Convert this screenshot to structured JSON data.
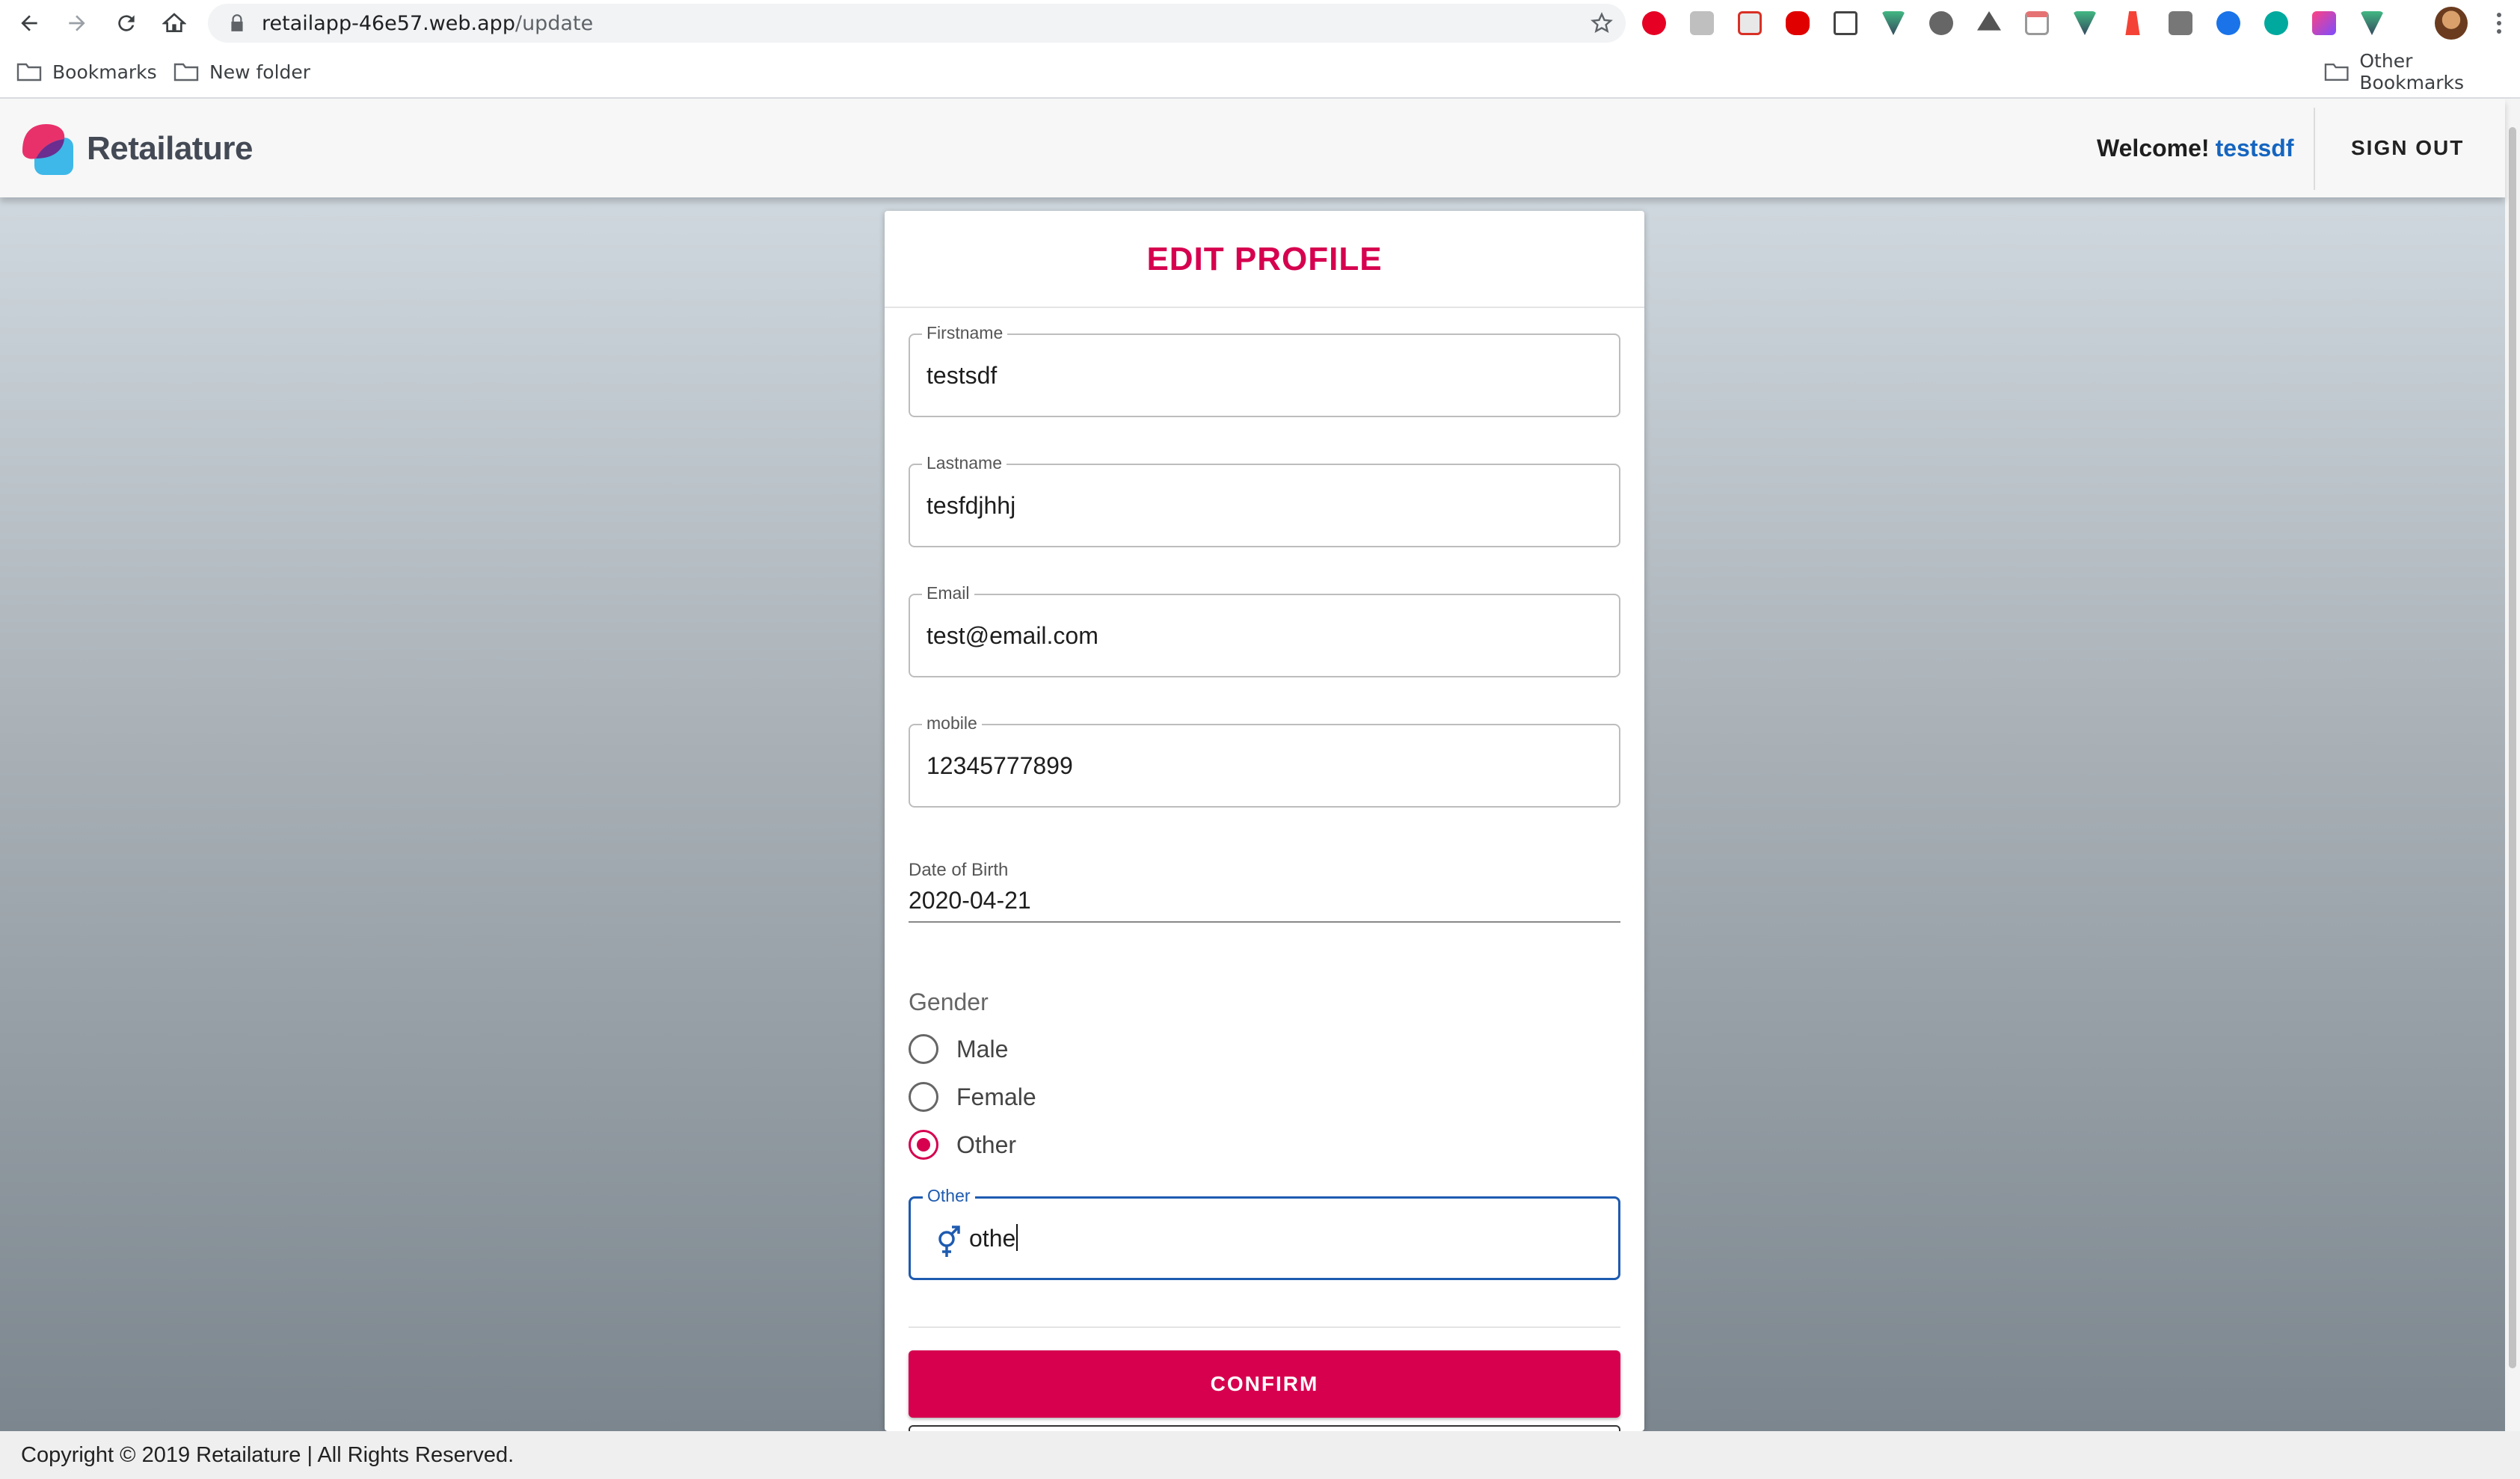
{
  "browser": {
    "url_host": "retailapp-46e57.web.app",
    "url_path": "/update",
    "bookmarks": [
      "Bookmarks",
      "New folder"
    ],
    "other_bookmarks": "Other Bookmarks"
  },
  "header": {
    "logo_text": "Retailature",
    "welcome": "Welcome!",
    "username": "testsdf",
    "signout": "SIGN OUT"
  },
  "form": {
    "title": "EDIT PROFILE",
    "firstname": {
      "label": "Firstname",
      "value": "testsdf"
    },
    "lastname": {
      "label": "Lastname",
      "value": "tesfdjhhj"
    },
    "email": {
      "label": "Email",
      "value": "test@email.com"
    },
    "mobile": {
      "label": "mobile",
      "value": "12345777899"
    },
    "dob": {
      "label": "Date of Birth",
      "value": "2020-04-21"
    },
    "gender": {
      "label": "Gender",
      "options": [
        "Male",
        "Female",
        "Other"
      ],
      "selected": "Other"
    },
    "other": {
      "label": "Other",
      "value": "othe"
    },
    "confirm": "CONFIRM"
  },
  "footer": {
    "copyright": "Copyright © 2019 Retailature | All Rights Reserved."
  },
  "colors": {
    "accent": "#d6004f",
    "focus": "#1e5bb0",
    "link": "#1565c0"
  }
}
